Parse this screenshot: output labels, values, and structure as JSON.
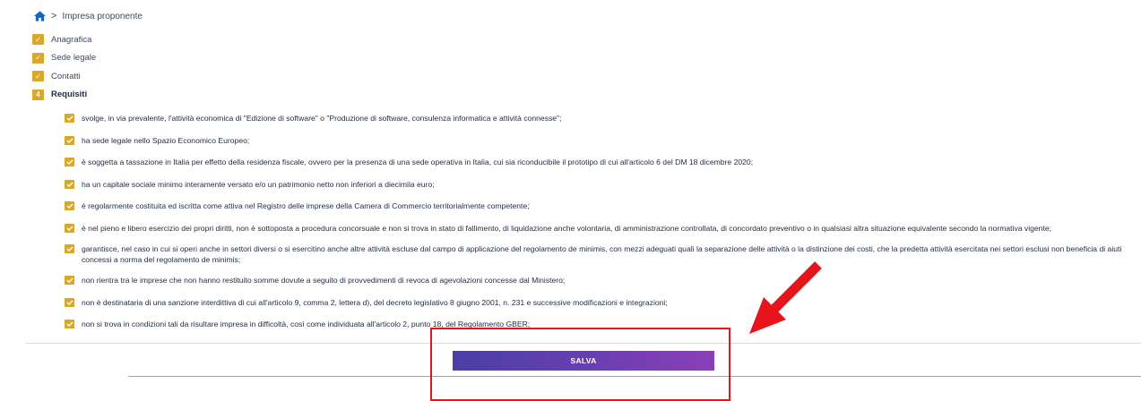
{
  "breadcrumb": {
    "current": "Impresa proponente"
  },
  "steps": [
    {
      "badge": "✓",
      "label": "Anagrafica"
    },
    {
      "badge": "✓",
      "label": "Sede legale"
    },
    {
      "badge": "✓",
      "label": "Contatti"
    },
    {
      "badge": "4",
      "label": "Requisiti"
    }
  ],
  "requirements": [
    "svolge, in via prevalente, l'attività economica di \"Edizione di software\" o \"Produzione di software, consulenza informatica e attività connesse\";",
    "ha sede legale nello Spazio Economico Europeo;",
    "è soggetta a tassazione in Italia per effetto della residenza fiscale, ovvero per la presenza di una sede operativa in Italia, cui sia riconducibile il prototipo di cui all'articolo 6 del DM 18 dicembre 2020;",
    "ha un capitale sociale minimo interamente versato e/o un patrimonio netto non inferiori a diecimila euro;",
    "è regolarmente costituita ed iscritta come attiva nel Registro delle imprese della Camera di Commercio territorialmente competente;",
    "è nel pieno e libero esercizio dei propri diritti, non è sottoposta a procedura concorsuale e non si trova in stato di fallimento, di liquidazione anche volontaria, di amministrazione controllata, di concordato preventivo o in qualsiasi altra situazione equivalente secondo la normativa vigente;",
    "garantisce, nel caso in cui si operi anche in settori diversi o si esercitino anche altre attività escluse dal campo di applicazione del regolamento de minimis, con mezzi adeguati quali la separazione delle attività o la distinzione dei costi, che la predetta attività esercitata nei settori esclusi non beneficia di aiuti concessi a norma del regolamento de minimis;",
    "non rientra tra le imprese che non hanno restituito somme dovute a seguito di provvedimenti di revoca di agevolazioni concesse dal Ministero;",
    "non è destinataria di una sanzione interdittiva di cui all'articolo 9, comma 2, lettera d), del decreto legislativo 8 giugno 2001, n. 231 e successive modificazioni e integrazioni;",
    "non si trova in condizioni tali da risultare impresa in difficoltà, così come individuata all'articolo 2, punto 18, del Regolamento GBER;"
  ],
  "save_button": {
    "label": "SALVA"
  },
  "colors": {
    "accent": "#d9a82b",
    "annotation": "#e8141b",
    "button_start": "#4a3fa6",
    "button_end": "#8a3fb8"
  }
}
